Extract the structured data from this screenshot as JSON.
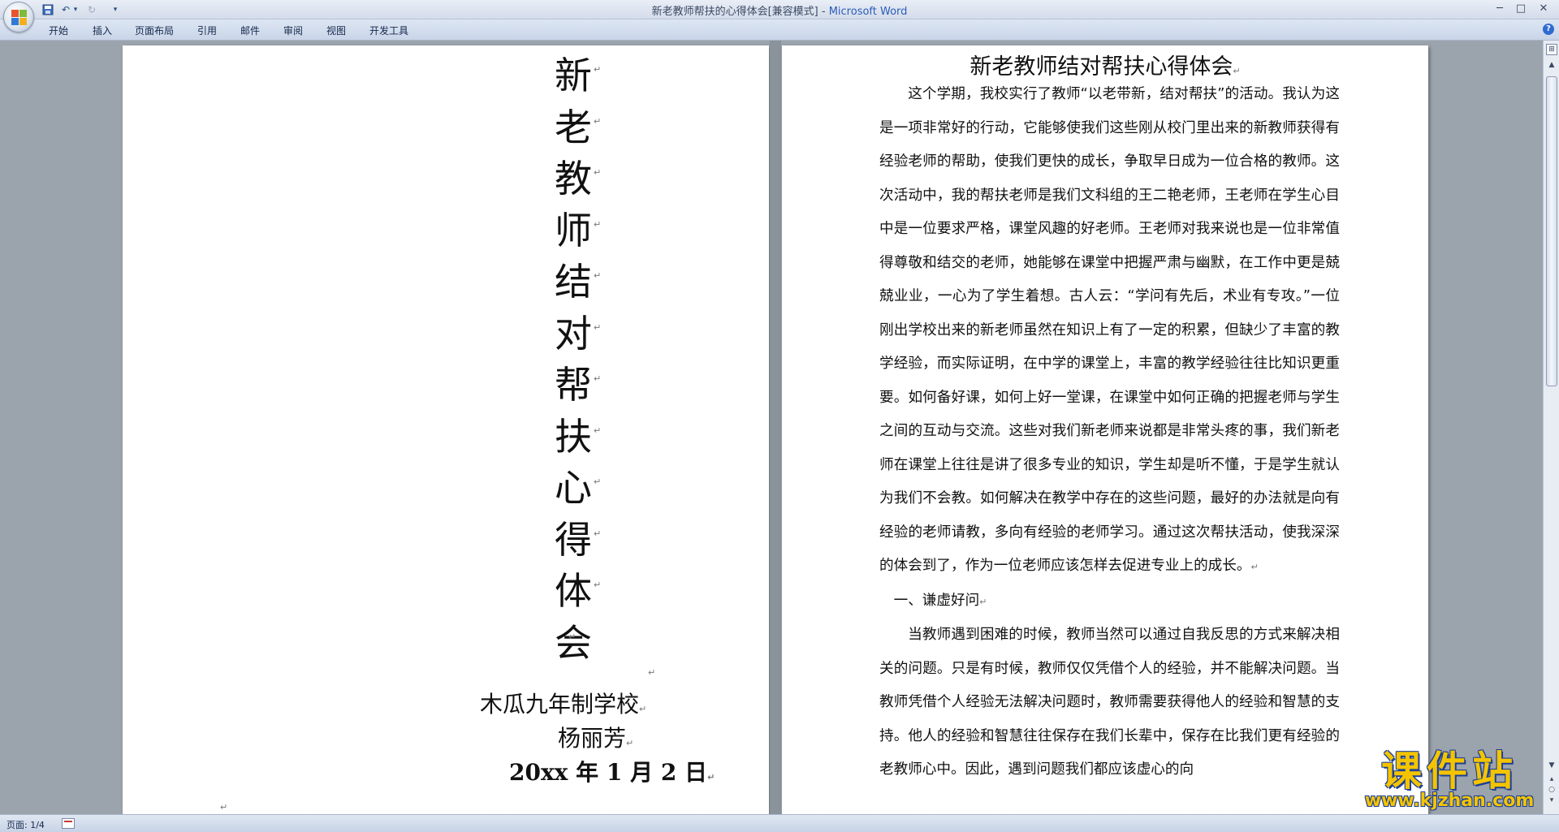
{
  "window": {
    "doc_name": "新老教师帮扶的心得体会",
    "mode": "[兼容模式]",
    "separator": " - ",
    "app_name": "Microsoft Word",
    "minimize": "─",
    "maximize": "□",
    "close": "✕"
  },
  "quick_access": {
    "dropdown": "▾"
  },
  "ribbon": {
    "tabs": [
      "开始",
      "插入",
      "页面布局",
      "引用",
      "邮件",
      "审阅",
      "视图",
      "开发工具"
    ],
    "help": "?"
  },
  "cover": {
    "title_chars": [
      "新",
      "老",
      "教",
      "师",
      "结",
      "对",
      "帮",
      "扶",
      "心",
      "得",
      "体",
      "会"
    ],
    "school": "木瓜九年制学校",
    "author": "杨丽芳",
    "date": "20xx 年 1 月 2 日",
    "paragraph_mark": "↵"
  },
  "article": {
    "title": "新老教师结对帮扶心得体会",
    "paragraphs": [
      "这个学期，我校实行了教师“以老带新，结对帮扶”的活动。我认为这是一项非常好的行动，它能够使我们这些刚从校门里出来的新教师获得有经验老师的帮助，使我们更快的成长，争取早日成为一位合格的教师。这次活动中，我的帮扶老师是我们文科组的王二艳老师，王老师在学生心目中是一位要求严格，课堂风趣的好老师。王老师对我来说也是一位非常值得尊敬和结交的老师，她能够在课堂中把握严肃与幽默，在工作中更是兢兢业业，一心为了学生着想。古人云：“学问有先后，术业有专攻。”一位刚出学校出来的新老师虽然在知识上有了一定的积累，但缺少了丰富的教学经验，而实际证明，在中学的课堂上，丰富的教学经验往往比知识更重要。如何备好课，如何上好一堂课，在课堂中如何正确的把握老师与学生之间的互动与交流。这些对我们新老师来说都是非常头疼的事，我们新老师在课堂上往往是讲了很多专业的知识，学生却是听不懂，于是学生就认为我们不会教。如何解决在教学中存在的这些问题，最好的办法就是向有经验的老师请教，多向有经验的老师学习。通过这次帮扶活动，使我深深的体会到了，作为一位老师应该怎样去促进专业上的成长。",
      "一、谦虚好问",
      "当教师遇到困难的时候，教师当然可以通过自我反思的方式来解决相关的问题。只是有时候，教师仅仅凭借个人的经验，并不能解决问题。当教师凭借个人经验无法解决问题时，教师需要获得他人的经验和智慧的支持。他人的经验和智慧往往保存在我们长辈中，保存在比我们更有经验的老教师心中。因此，遇到问题我们都应该虚心的向"
    ]
  },
  "status": {
    "page": "页面: 1/4"
  },
  "watermark": {
    "main": "课件站",
    "sub": "www.kjzhan.com"
  },
  "colors": {
    "app_blue": "#2b5cb8",
    "workspace": "#9ba3ad",
    "watermark_yellow": "#f4c400",
    "watermark_blue": "#1c3f95"
  }
}
